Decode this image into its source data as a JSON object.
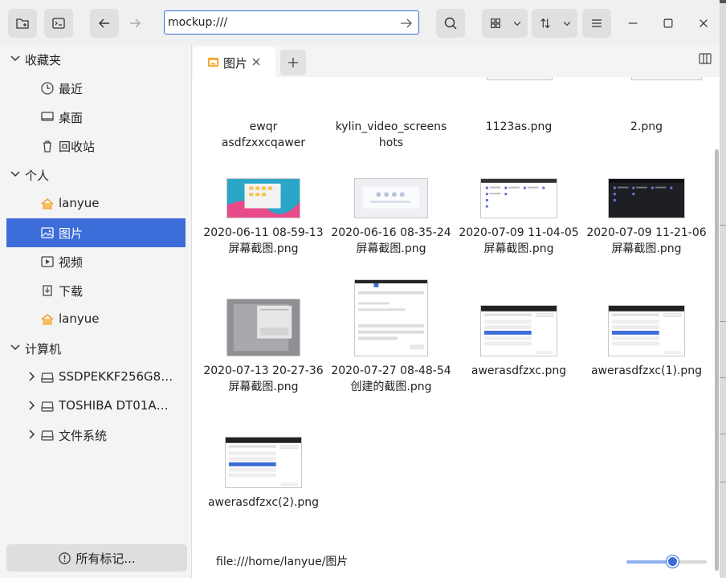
{
  "window": {
    "accent": "#3d6dd9"
  },
  "toolbar": {
    "address_value": "mockup:///",
    "icons": [
      "new-folder-icon",
      "terminal-icon",
      "back-icon",
      "forward-icon",
      "go-icon",
      "search-icon",
      "grid-view-icon",
      "chevron-down-icon",
      "sort-icon",
      "chevron-down-icon",
      "menu-icon",
      "minimize-icon",
      "maximize-icon",
      "close-icon"
    ]
  },
  "sidebar": {
    "groups": [
      {
        "label": "收藏夹",
        "items": [
          {
            "label": "最近",
            "icon": "clock-icon"
          },
          {
            "label": "桌面",
            "icon": "desktop-icon"
          },
          {
            "label": "回收站",
            "icon": "trash-icon"
          }
        ]
      },
      {
        "label": "个人",
        "items": [
          {
            "label": "lanyue",
            "icon": "home-icon"
          },
          {
            "label": "图片",
            "icon": "picture-icon",
            "selected": true
          },
          {
            "label": "视频",
            "icon": "video-icon"
          },
          {
            "label": "下载",
            "icon": "download-icon"
          },
          {
            "label": "lanyue",
            "icon": "home-icon"
          }
        ]
      },
      {
        "label": "计算机",
        "items": [
          {
            "label": "SSDPEKKF256G8…",
            "icon": "drive-icon"
          },
          {
            "label": "TOSHIBA DT01A…",
            "icon": "drive-icon"
          },
          {
            "label": "文件系统",
            "icon": "drive-icon"
          }
        ]
      }
    ],
    "all_tags_label": "所有标记..."
  },
  "tabs": [
    {
      "label": "图片",
      "icon": "folder-picture-icon"
    }
  ],
  "files": [
    {
      "name": "ewqr asdfzxxcqawer",
      "kind": "partial"
    },
    {
      "name": "kylin_video_screenshots",
      "kind": "partial"
    },
    {
      "name": "1123as.png",
      "kind": "partial"
    },
    {
      "name": "2.png",
      "kind": "partial"
    },
    {
      "name": "2020-06-11 08-59-13 屏幕截图.png",
      "kind": "desktop"
    },
    {
      "name": "2020-06-16 08-35-24 屏幕截图.png",
      "kind": "light"
    },
    {
      "name": "2020-07-09 11-04-05 屏幕截图.png",
      "kind": "filelist"
    },
    {
      "name": "2020-07-09 11-21-06 屏幕截图.png",
      "kind": "darklist"
    },
    {
      "name": "2020-07-13 20-27-36 屏幕截图.png",
      "kind": "dialog"
    },
    {
      "name": "2020-07-27 08-48-54 创建的截图.png",
      "kind": "form"
    },
    {
      "name": "awerasdfzxc.png",
      "kind": "smalldialog"
    },
    {
      "name": "awerasdfzxc(1).png",
      "kind": "smalldialog"
    },
    {
      "name": "awerasdfzxc(2).png",
      "kind": "smalldialog"
    }
  ],
  "status": {
    "path": "file:///home/lanyue/图片",
    "zoom_fraction": 0.58
  }
}
